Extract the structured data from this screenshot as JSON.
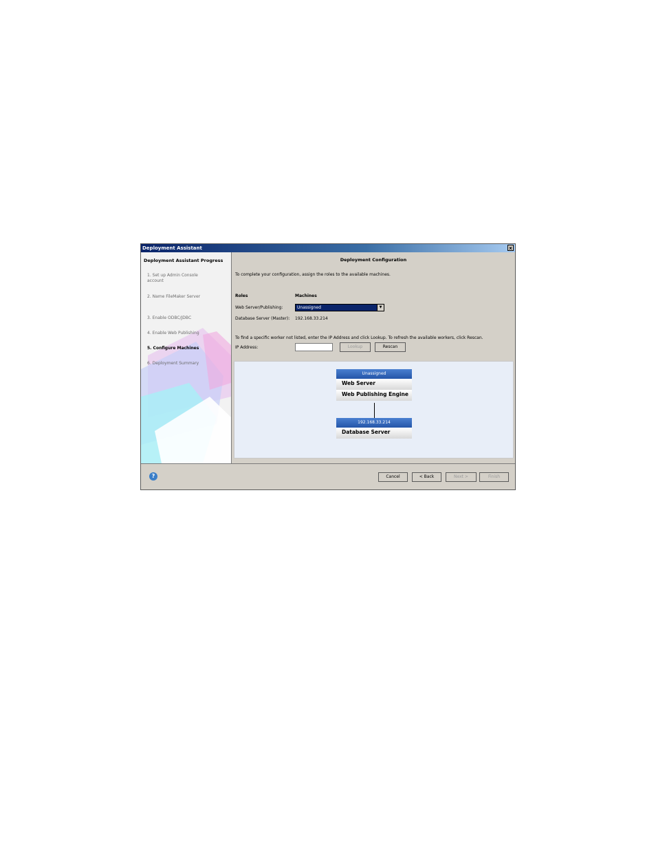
{
  "window": {
    "title": "Deployment Assistant",
    "close_label": "x"
  },
  "sidebar": {
    "title": "Deployment Assistant Progress",
    "steps": [
      {
        "label": "1. Set up Admin Console account"
      },
      {
        "label": "2. Name FileMaker Server"
      },
      {
        "label": "3. Enable ODBC/JDBC"
      },
      {
        "label": "4. Enable Web Publishing"
      },
      {
        "label": "5. Configure Machines"
      },
      {
        "label": "6. Deployment Summary"
      }
    ]
  },
  "main": {
    "heading": "Deployment Configuration",
    "intro": "To complete your configuration, assign the roles to the available machines.",
    "roles_header": "Roles",
    "machines_header": "Machines",
    "web_role_label": "Web Server/Publishing:",
    "web_role_value": "Unassigned",
    "db_role_label": "Database Server (Master):",
    "db_role_value": "192.168.33.214",
    "find_text": "To find a specific worker not listed, enter the IP Address and click Lookup.  To refresh the available workers, click Rescan.",
    "ip_label": "IP Address:",
    "ip_value": "",
    "lookup_label": "Lookup",
    "rescan_label": "Rescan"
  },
  "diagram": {
    "top_machine": "Unassigned",
    "top_roles": [
      "Web Server",
      "Web Publishing Engine"
    ],
    "bottom_machine": "192.168.33.214",
    "bottom_roles": [
      "Database Server"
    ]
  },
  "footer": {
    "cancel_label": "Cancel",
    "back_label": "< Back",
    "next_label": "Next >",
    "finish_label": "Finish"
  }
}
